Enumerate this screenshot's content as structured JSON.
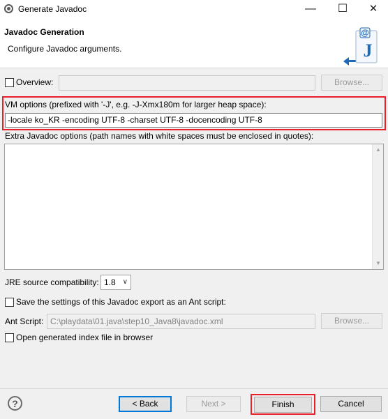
{
  "window": {
    "title": "Generate Javadoc",
    "minimize_glyph": "—",
    "maximize_glyph": "☐",
    "close_glyph": "✕"
  },
  "header": {
    "title": "Javadoc Generation",
    "description": "Configure Javadoc arguments.",
    "logo_icon": "javadoc-logo-icon"
  },
  "form": {
    "overview": {
      "label": "Overview:",
      "checked": false,
      "value": "",
      "browse_label": "Browse..."
    },
    "vm_options": {
      "label": "VM options (prefixed with '-J', e.g. -J-Xmx180m for larger heap space):",
      "value": "-locale ko_KR -encoding UTF-8 -charset UTF-8 -docencoding UTF-8"
    },
    "extra_options": {
      "label": "Extra Javadoc options (path names with white spaces must be enclosed in quotes):",
      "value": ""
    },
    "jre": {
      "label": "JRE source compatibility:",
      "value": "1.8"
    },
    "save_ant": {
      "label": "Save the settings of this Javadoc export as an Ant script:",
      "checked": false
    },
    "ant_script": {
      "label": "Ant Script:",
      "value": "C:\\playdata\\01.java\\step10_Java8\\javadoc.xml",
      "browse_label": "Browse..."
    },
    "open_browser": {
      "label": "Open generated index file in browser",
      "checked": false
    }
  },
  "footer": {
    "help_glyph": "?",
    "back_label": "< Back",
    "next_label": "Next >",
    "finish_label": "Finish",
    "cancel_label": "Cancel"
  },
  "colors": {
    "highlight": "#e8202a",
    "focus_blue": "#0078d7",
    "logo_blue": "#1e6ab6"
  }
}
